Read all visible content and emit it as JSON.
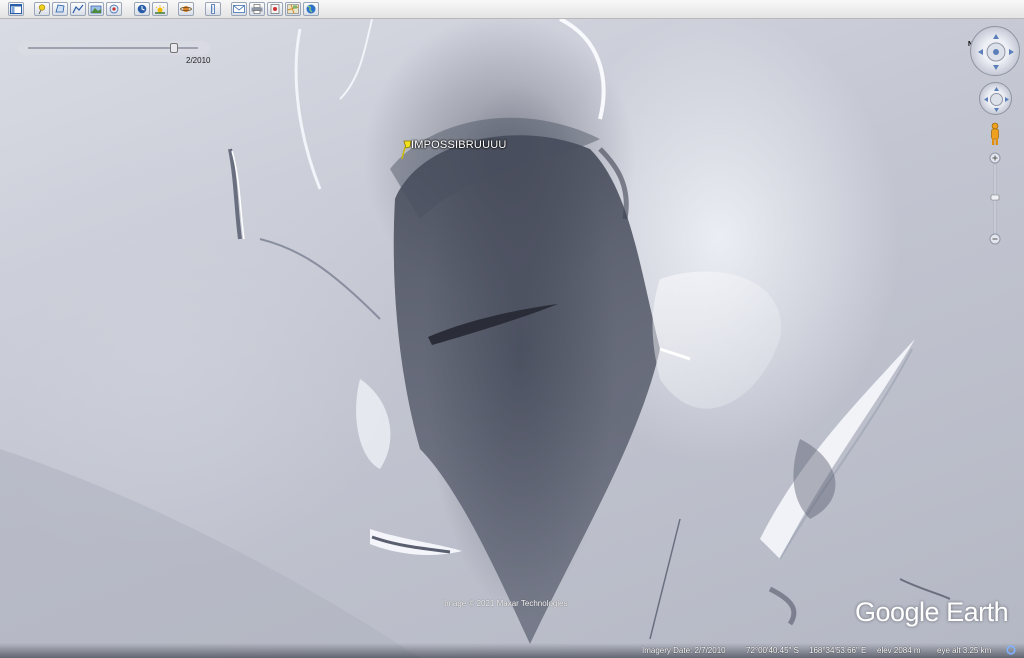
{
  "toolbar": {
    "buttons": [
      {
        "id": "sidebar",
        "icon": "sidebar-icon"
      },
      {
        "id": "placemark",
        "icon": "pushpin-icon"
      },
      {
        "id": "polygon",
        "icon": "polygon-icon"
      },
      {
        "id": "path",
        "icon": "path-icon"
      },
      {
        "id": "overlay",
        "icon": "image-overlay-icon"
      },
      {
        "id": "tour",
        "icon": "record-tour-icon"
      },
      {
        "id": "historical",
        "icon": "clock-icon"
      },
      {
        "id": "sunlight",
        "icon": "sun-icon"
      },
      {
        "id": "planets",
        "icon": "planet-icon"
      },
      {
        "id": "ruler",
        "icon": "ruler-icon"
      },
      {
        "id": "email",
        "icon": "envelope-icon"
      },
      {
        "id": "print",
        "icon": "printer-icon"
      },
      {
        "id": "save-image",
        "icon": "save-image-icon"
      },
      {
        "id": "maps",
        "icon": "map-icon"
      },
      {
        "id": "earth",
        "icon": "globe-icon"
      }
    ]
  },
  "time_slider": {
    "date": "2/2010"
  },
  "placemark": {
    "label": "IMPOSSIBRUUUU",
    "color": "#f2e21c"
  },
  "navigation": {
    "north": "N",
    "pegman": "pegman-icon"
  },
  "attribution": {
    "image_credit": "Image © 2021 Maxar Technologies",
    "logo": "Google Earth"
  },
  "status": {
    "imagery_date": "Imagery Date: 2/7/2010",
    "latitude": "72°00'40.45\" S",
    "longitude": "168°34'53.66\" E",
    "elevation": "elev  2084 m",
    "eye_alt": "eye alt  3.25 km",
    "streaming": "streaming-icon"
  }
}
